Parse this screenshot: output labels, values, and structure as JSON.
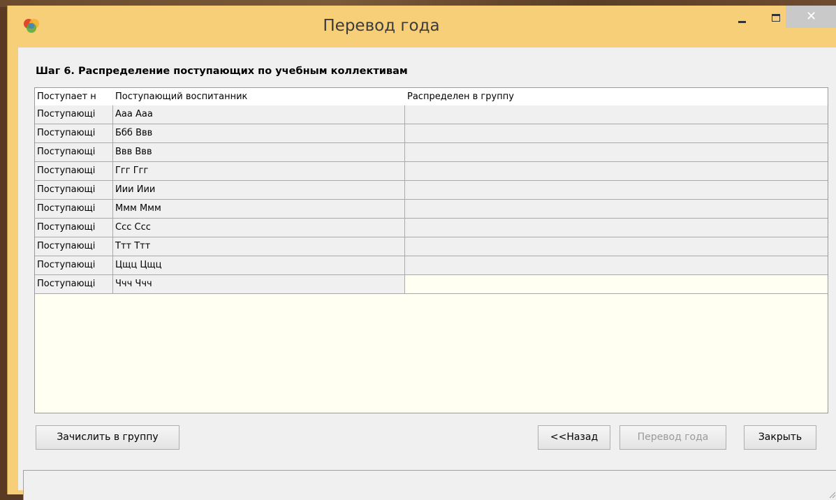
{
  "window": {
    "title": "Перевод года",
    "close_symbol": "✕"
  },
  "step": {
    "title": "Шаг 6. Распределение поступающих по учебным коллективам"
  },
  "table": {
    "columns": [
      "Поступает н",
      "Поступающий воспитанник",
      "Распределен в группу"
    ],
    "rows": [
      [
        "Поступающі",
        "Ааа Ааа",
        ""
      ],
      [
        "Поступающі",
        "Ббб Ввв",
        ""
      ],
      [
        "Поступающі",
        "Ввв Ввв",
        ""
      ],
      [
        "Поступающі",
        "Ггг Ггг",
        ""
      ],
      [
        "Поступающі",
        "Иии Иии",
        ""
      ],
      [
        "Поступающі",
        "Ммм Ммм",
        ""
      ],
      [
        "Поступающі",
        "Ссс Ссс",
        ""
      ],
      [
        "Поступающі",
        "Ттт Ттт",
        ""
      ],
      [
        "Поступающі",
        "Цщц Цщц",
        ""
      ],
      [
        "Поступающі",
        "Ччч Ччч",
        ""
      ]
    ]
  },
  "buttons": {
    "enroll": "Зачислить в группу",
    "back": "<<Назад",
    "transfer": "Перевод года",
    "close": "Закрыть"
  },
  "colors": {
    "title_bar": "#f7cf79",
    "grid_bg": "#fffff2"
  }
}
